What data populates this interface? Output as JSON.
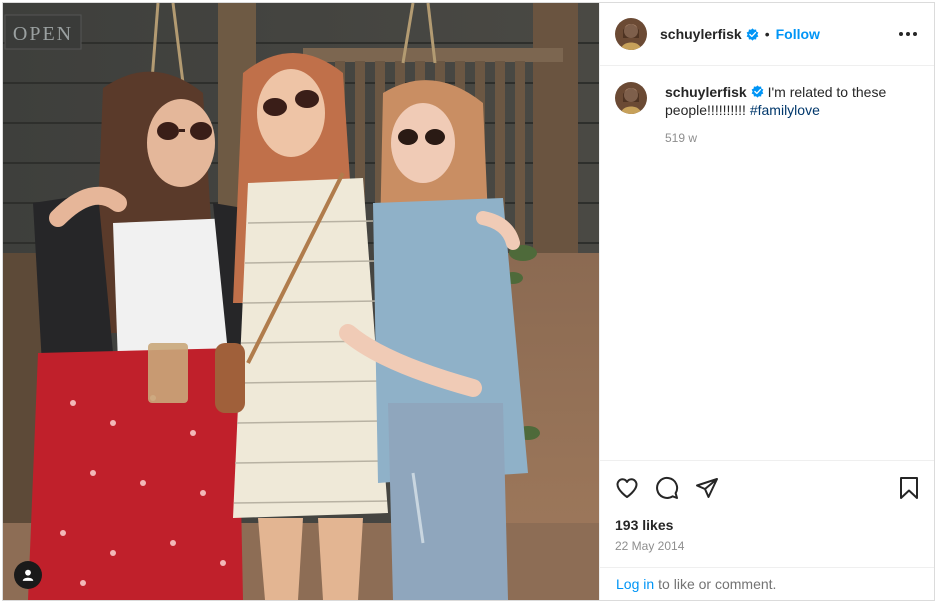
{
  "header": {
    "username": "schuylerfisk",
    "separator": "•",
    "follow_label": "Follow"
  },
  "caption": {
    "username": "schuylerfisk",
    "text": "I'm related to these people!!!!!!!!!!",
    "hashtag": "#familylove",
    "age": "519 w"
  },
  "photo": {
    "sign_text": "OPEN"
  },
  "actions": {
    "icons": [
      "heart-icon",
      "comment-icon",
      "share-icon",
      "bookmark-icon"
    ]
  },
  "stats": {
    "likes": "193 likes",
    "date": "22 May 2014"
  },
  "login": {
    "link_label": "Log in",
    "rest": "to like or comment."
  },
  "colors": {
    "accent": "#0095f6",
    "hashtag": "#00376b",
    "muted": "#8e8e8e"
  }
}
